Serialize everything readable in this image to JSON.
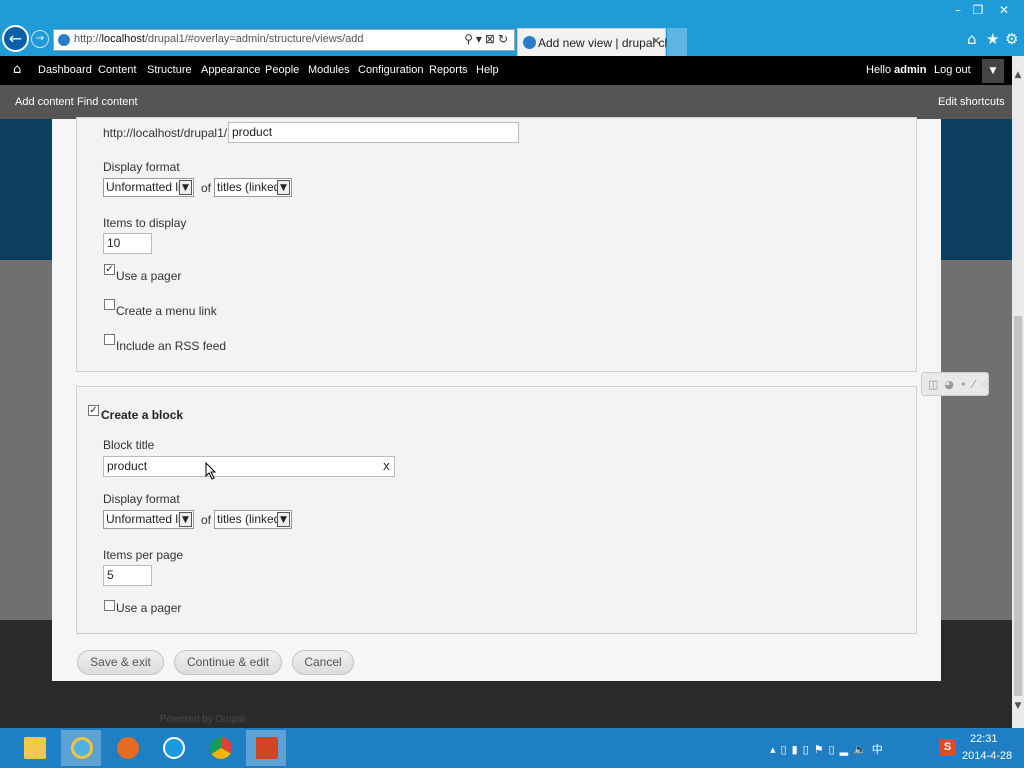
{
  "window_controls": {
    "minimize": "–",
    "restore": "❐",
    "close": "✕"
  },
  "browser": {
    "back_icon": "back-arrow-icon",
    "forward_icon": "forward-arrow-icon",
    "address_prefix": "http://",
    "address_host": "localhost",
    "address_path": "/drupal1/#overlay=admin/structure/views/add",
    "address_tools": "⚲▾⊠↻",
    "tab_title": "Add new view | drupal cl...",
    "tab_close": "✕",
    "home_icon": "⌂",
    "favorites_icon": "★",
    "settings_icon": "⚙"
  },
  "toolbar": {
    "home_icon": "⌂",
    "items": [
      "Dashboard",
      "Content",
      "Structure",
      "Appearance",
      "People",
      "Modules",
      "Configuration",
      "Reports",
      "Help"
    ],
    "hello_prefix": "Hello ",
    "user": "admin",
    "logout": "Log out",
    "toggle": "▼"
  },
  "shortcuts": {
    "add_content": "Add content",
    "find_content": "Find content",
    "edit_shortcuts": "Edit shortcuts"
  },
  "page_section": {
    "path_prefix": "http://localhost/drupal1/",
    "path_value": "product",
    "display_format_label": "Display format",
    "format_value": "Unformatted list",
    "of_label": "of",
    "of_value": "titles (linked)",
    "items_label": "Items to display",
    "items_value": "10",
    "use_pager_label": "Use a pager",
    "use_pager_checked": true,
    "menu_link_label": "Create a menu link",
    "rss_label": "Include an RSS feed"
  },
  "block_section": {
    "legend": "Create a block",
    "block_title_label": "Block title",
    "block_title_value": "product",
    "clear": "x",
    "display_format_label": "Display format",
    "format_value": "Unformatted list",
    "of_label": "of",
    "of_value": "titles (linked)",
    "items_label": "Items per page",
    "items_value": "5",
    "use_pager_label": "Use a pager"
  },
  "buttons": {
    "save_exit": "Save & exit",
    "continue_edit": "Continue & edit",
    "cancel": "Cancel"
  },
  "checkmark": "✓",
  "select_arrow": "▼",
  "contextual": "◫◕•⁄⁘",
  "footer": {
    "powered": "Powered by Drupal"
  },
  "scroll": {
    "up": "▲",
    "down": "▼"
  },
  "taskbar": {
    "apps": [
      "file-explorer-icon",
      "internet-explorer-icon",
      "firefox-icon",
      "skype-icon",
      "chrome-icon",
      "powerpoint-icon"
    ],
    "tray_icons": "▴▯▮▯⚑▯▂🔈中",
    "tray_s": "S",
    "time": "22:31",
    "date": "2014-4-28"
  },
  "colors": {
    "accent": "#1f9bd8",
    "toolbar": "#000000",
    "shortcuts": "#555555",
    "taskbar": "#1f7fc4"
  }
}
